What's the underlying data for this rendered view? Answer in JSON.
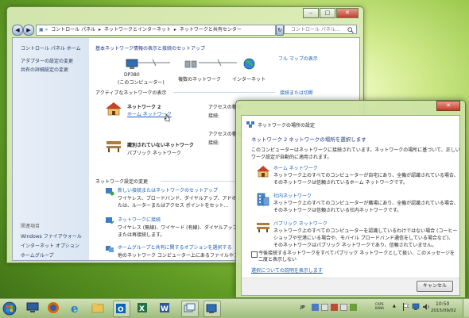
{
  "main_window": {
    "address": [
      "コントロール パネル",
      "ネットワークとインターネット",
      "ネットワークと共有センター"
    ],
    "search_placeholder": "コントロール パネル…",
    "left_nav": {
      "home": "コントロール パネル ホーム",
      "adapter": "アダプターの設定の変更",
      "advanced": "共有の詳細設定の変更",
      "see_also_title": "関連項目",
      "see_also": [
        "Windows ファイアウォール",
        "インターネット オプション",
        "ホームグループ"
      ]
    },
    "heading": "基本ネットワーク情報の表示と接続のセットアップ",
    "full_map": "フル マップの表示",
    "map": {
      "computer": "DP380",
      "computer_sub": "(このコンピューター)",
      "network": "複数のネットワーク",
      "internet": "インターネット"
    },
    "active_title": "アクティブなネットワークの表示",
    "connect_disconnect": "接続または切断",
    "networks": [
      {
        "name": "ネットワーク 2",
        "type": "ホーム ネットワーク",
        "access_label": "アクセスの種類:",
        "conn_label": "接続:"
      },
      {
        "name": "識別されていないネットワーク",
        "type": "パブリック ネットワーク",
        "access_label": "アクセスの種類:",
        "conn_label": "接続:"
      }
    ],
    "settings_title": "ネットワーク設定の変更",
    "settings": [
      {
        "title": "新しい接続またはネットワークのセットアップ",
        "desc": [
          "ワイヤレス、ブロードバンド、ダイヤルアップ、アドホック、…",
          "たは、ルーターまたはアクセス ポイントをセット…"
        ]
      },
      {
        "title": "ネットワークに接続",
        "desc": [
          "ワイヤレス (無線)、ワイヤード (有線)、ダイヤルアップ、…",
          "または再接続します。"
        ]
      },
      {
        "title": "ホームグループと共有に関するオプションを選択する",
        "desc": [
          "他のネットワーク コンピューター上にあるファイルやプリン…"
        ]
      }
    ]
  },
  "dialog": {
    "title": "ネットワークの場所の設定",
    "heading": "ネットワーク 2 ネットワークの場所を選択します",
    "intro": [
      "このコンピューターはネットワークに接続されています。ネットワークの場所に基づいて、正しいネット",
      "ワーク設定が自動的に適用されます。"
    ],
    "options": [
      {
        "title": "ホーム ネットワーク",
        "desc": [
          "ネットワーク上のすべてのコンピューターが自宅にあり、全機が認識されている場合、",
          "そのネットワークは信頼されているホーム ネットワークです。"
        ]
      },
      {
        "title": "社内ネットワーク",
        "desc": [
          "ネットワーク上のすべてのコンピューターが職場にあり、全機が認識されている場合、",
          "そのネットワークは信頼されている社内ネットワークです。"
        ]
      },
      {
        "title": "パブリック ネットワーク",
        "desc": [
          "ネットワーク上のすべてのコンピューターを認識しているわけではない場合 (コーヒー",
          "ショップや空港にいる場合や、モバイル ブロードバンド通信をしている場合など)、",
          "そのネットワークはパブリック ネットワークであり、信頼されていません。"
        ]
      }
    ],
    "checkbox_label": "今後接続するネットワークをすべてパブリック ネットワークとして扱い、このメッセージを二度と表示しない",
    "help_link": "選択についての説明を表示します",
    "cancel": "キャンセル"
  },
  "taskbar": {
    "lang": "JP",
    "ime": "CAPS KANA",
    "time": "10:50",
    "date": "2015/09/02"
  }
}
